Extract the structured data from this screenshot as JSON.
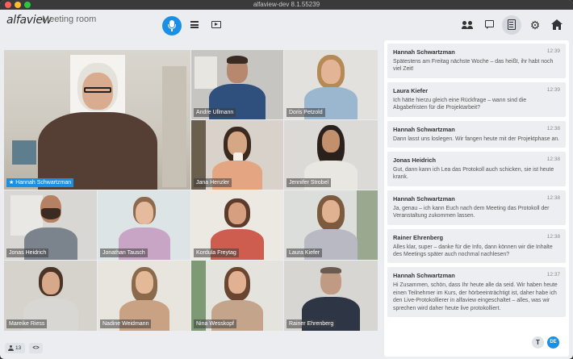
{
  "window": {
    "title": "alfaview-dev 8.1.55239"
  },
  "header": {
    "brand": "alfaview",
    "room_name": "Meeting room",
    "icons": [
      "microphone-icon",
      "list-icon",
      "screen-share-icon",
      "participants-icon",
      "chat-icon",
      "protocol-icon",
      "settings-icon",
      "home-icon"
    ]
  },
  "colors": {
    "accent": "#1a8fe3",
    "active_border": "#35a3f0",
    "panel": "#ffffff",
    "message_bg": "#eceef1",
    "background": "#ebedf0"
  },
  "video_tiles": [
    {
      "name": "Hannah Schwartzman",
      "active": true,
      "pinned": true
    },
    {
      "name": "Andre Ullmann"
    },
    {
      "name": "Doris Petzold"
    },
    {
      "name": "Jana Henzler"
    },
    {
      "name": "Jennifer Strobel"
    },
    {
      "name": "Jonas Heidrich"
    },
    {
      "name": "Jonathan Tausch"
    },
    {
      "name": "Kordula Freytag"
    },
    {
      "name": "Laura Kiefer"
    },
    {
      "name": "Mareike Riess"
    },
    {
      "name": "Nadine Weidmann"
    },
    {
      "name": "Nina Wesskopf"
    },
    {
      "name": "Rainer Ehrenberg"
    }
  ],
  "chat": {
    "messages": [
      {
        "author": "Hannah Schwartzman",
        "time": "12:39",
        "text": "Spätestens am Freitag nächste Woche – das heißt, ihr habt noch viel Zeit!"
      },
      {
        "author": "Laura Kiefer",
        "time": "12:39",
        "text": "Ich hätte hierzu gleich eine Rückfrage – wann sind die Abgabefristen für die Projektarbeit?"
      },
      {
        "author": "Hannah Schwartzman",
        "time": "12:38",
        "text": "Dann lasst uns loslegen. Wir fangen heute mit der Projektphase an."
      },
      {
        "author": "Jonas Heidrich",
        "time": "12:38",
        "text": "Gut, dann kann ich Lea das Protokoll auch schicken, sie ist heute krank."
      },
      {
        "author": "Hannah Schwartzman",
        "time": "12:38",
        "text": "Ja, genau – ich kann Euch nach dem Meeting das Protokoll der Veranstaltung zukommen lassen."
      },
      {
        "author": "Rainer Ehrenberg",
        "time": "12:38",
        "text": "Alles klar, super – danke für die Info, dann können wir die Inhalte des Meetings später auch nochmal nachlesen?"
      },
      {
        "author": "Hannah Schwartzman",
        "time": "12:37",
        "text": "Hi Zusammen, schön, dass Ihr heute alle da seid. Wir haben heute einen Teilnehmer im Kurs, der hörbeeinträchtigt ist, daher habe ich den Live-Protokollierer in alfaview eingeschaltet – alles, was wir sprechen wird daher heute live protokolliert."
      }
    ],
    "font_button": "T",
    "language_button": "DE"
  },
  "footer": {
    "participant_count": "13",
    "expand_label": "<>"
  }
}
